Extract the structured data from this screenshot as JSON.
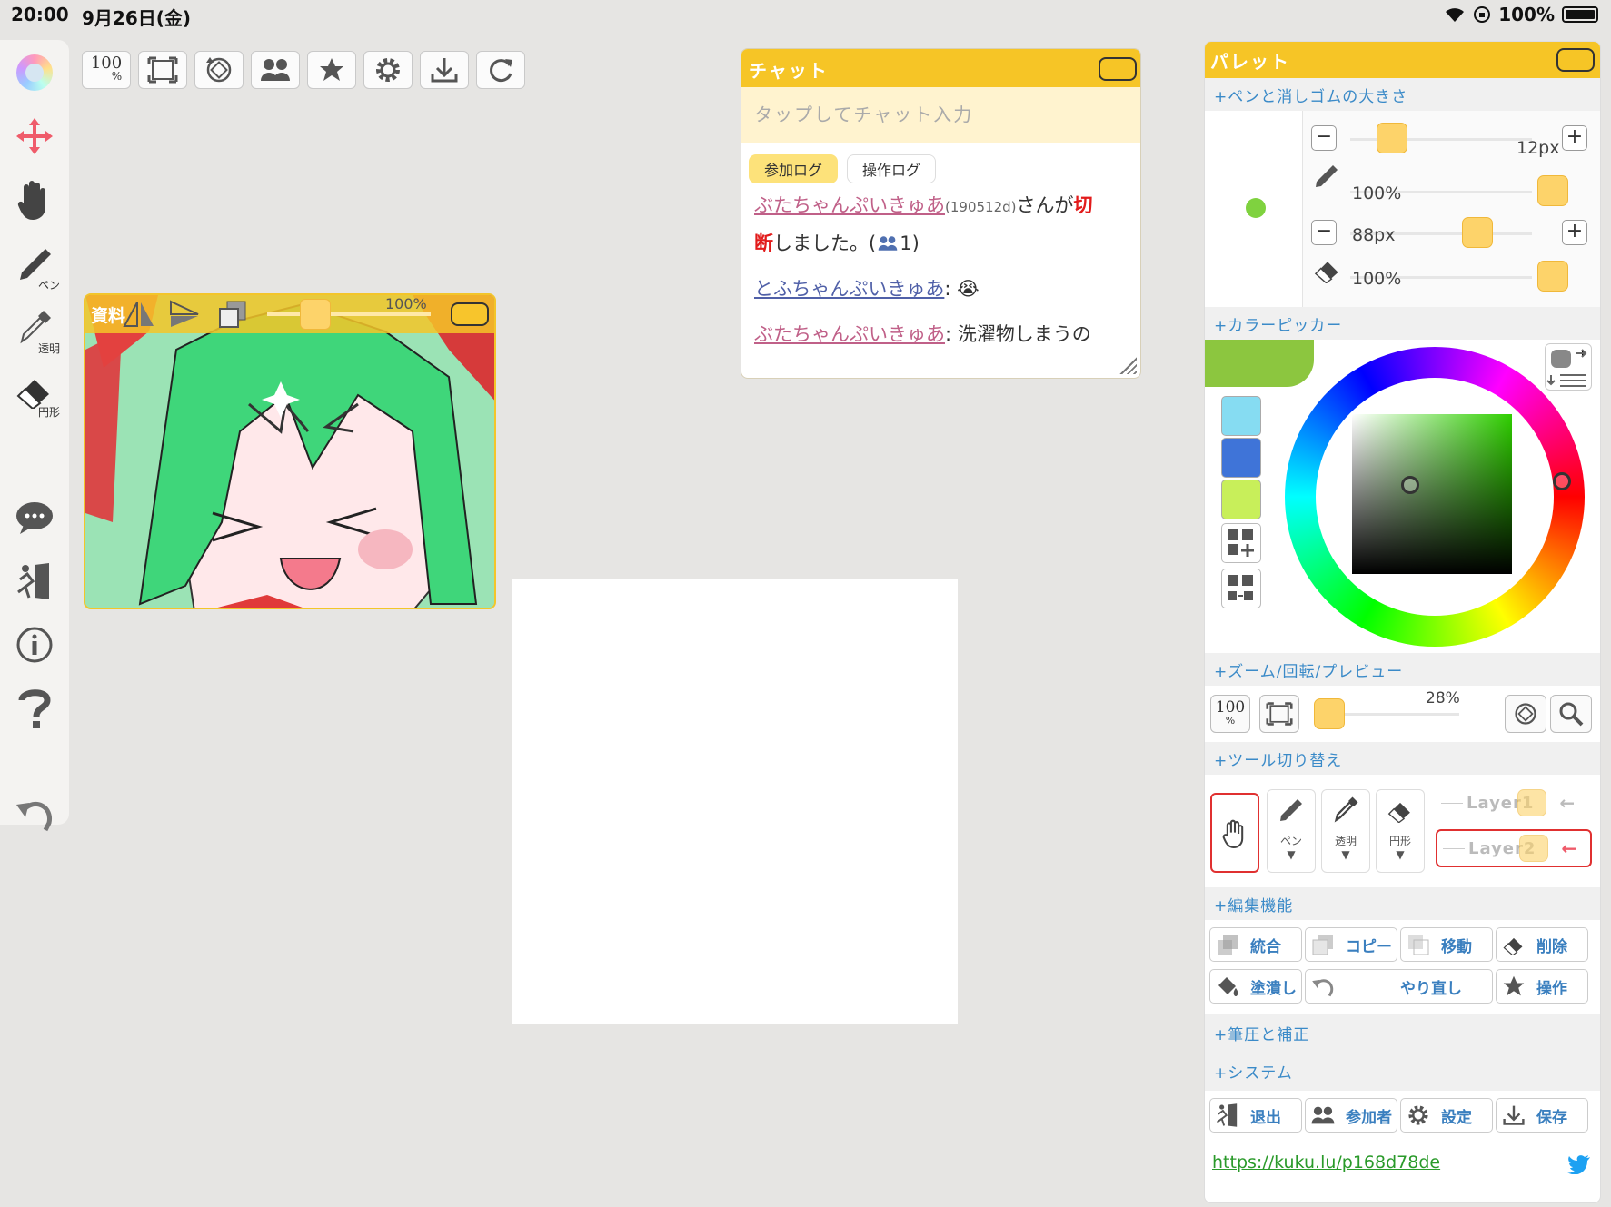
{
  "status": {
    "time": "20:00",
    "date": "9月26日(金)",
    "battery": "100%"
  },
  "left_toolbar": {
    "pen_label": "ペン",
    "transparent_label": "透明",
    "circle_label": "円形"
  },
  "top_toolbar": {
    "zoom_label": "100",
    "zoom_unit": "%"
  },
  "reference": {
    "title": "資料",
    "zoom": "100%"
  },
  "chat": {
    "title": "チャット",
    "placeholder": "タップしてチャット入力",
    "tab_join": "参加ログ",
    "tab_ops": "操作ログ",
    "messages": [
      {
        "user": "ぶたちゃんぷいきゅあ",
        "id": "(190512d)",
        "pre": "さんが",
        "red1": "切",
        "red2": "断",
        "post": "しました。(",
        "count": "1)"
      },
      {
        "user": "とふちゃんぷいきゅあ",
        "sep": ":",
        "text": "😭"
      },
      {
        "user": "ぶたちゃんぷいきゅあ",
        "sep": ":",
        "text": "洗濯物しまうの"
      }
    ]
  },
  "palette": {
    "title": "パレット",
    "sections": {
      "size": "+ペンと消しゴムの大きさ",
      "picker": "+カラーピッカー",
      "zoom": "+ズーム/回転/プレビュー",
      "tools": "+ツール切り替え",
      "edit": "+編集機能",
      "pressure": "+筆圧と補正",
      "system": "+システム"
    },
    "pen_size": "12px",
    "pen_opacity": "100%",
    "eraser_size": "88px",
    "eraser_opacity": "100%",
    "pen_color": "#7fd23f",
    "swatches": [
      "#86dcf2",
      "#3f74d8",
      "#c8ef5a"
    ],
    "zoom_value": "28%",
    "zoom_btn": "100",
    "zoom_unit": "%",
    "tool_labels": {
      "pen": "ペン",
      "transparent": "透明",
      "circle": "円形"
    },
    "layers": [
      "Layer1",
      "Layer2"
    ],
    "edit_buttons": {
      "merge": "統合",
      "copy": "コピー",
      "move": "移動",
      "delete": "削除",
      "fill": "塗潰し",
      "redo": "やり直し",
      "ops": "操作"
    },
    "system_buttons": {
      "exit": "退出",
      "members": "参加者",
      "settings": "設定",
      "save": "保存"
    },
    "link": "https://kuku.lu/p168d78de"
  }
}
